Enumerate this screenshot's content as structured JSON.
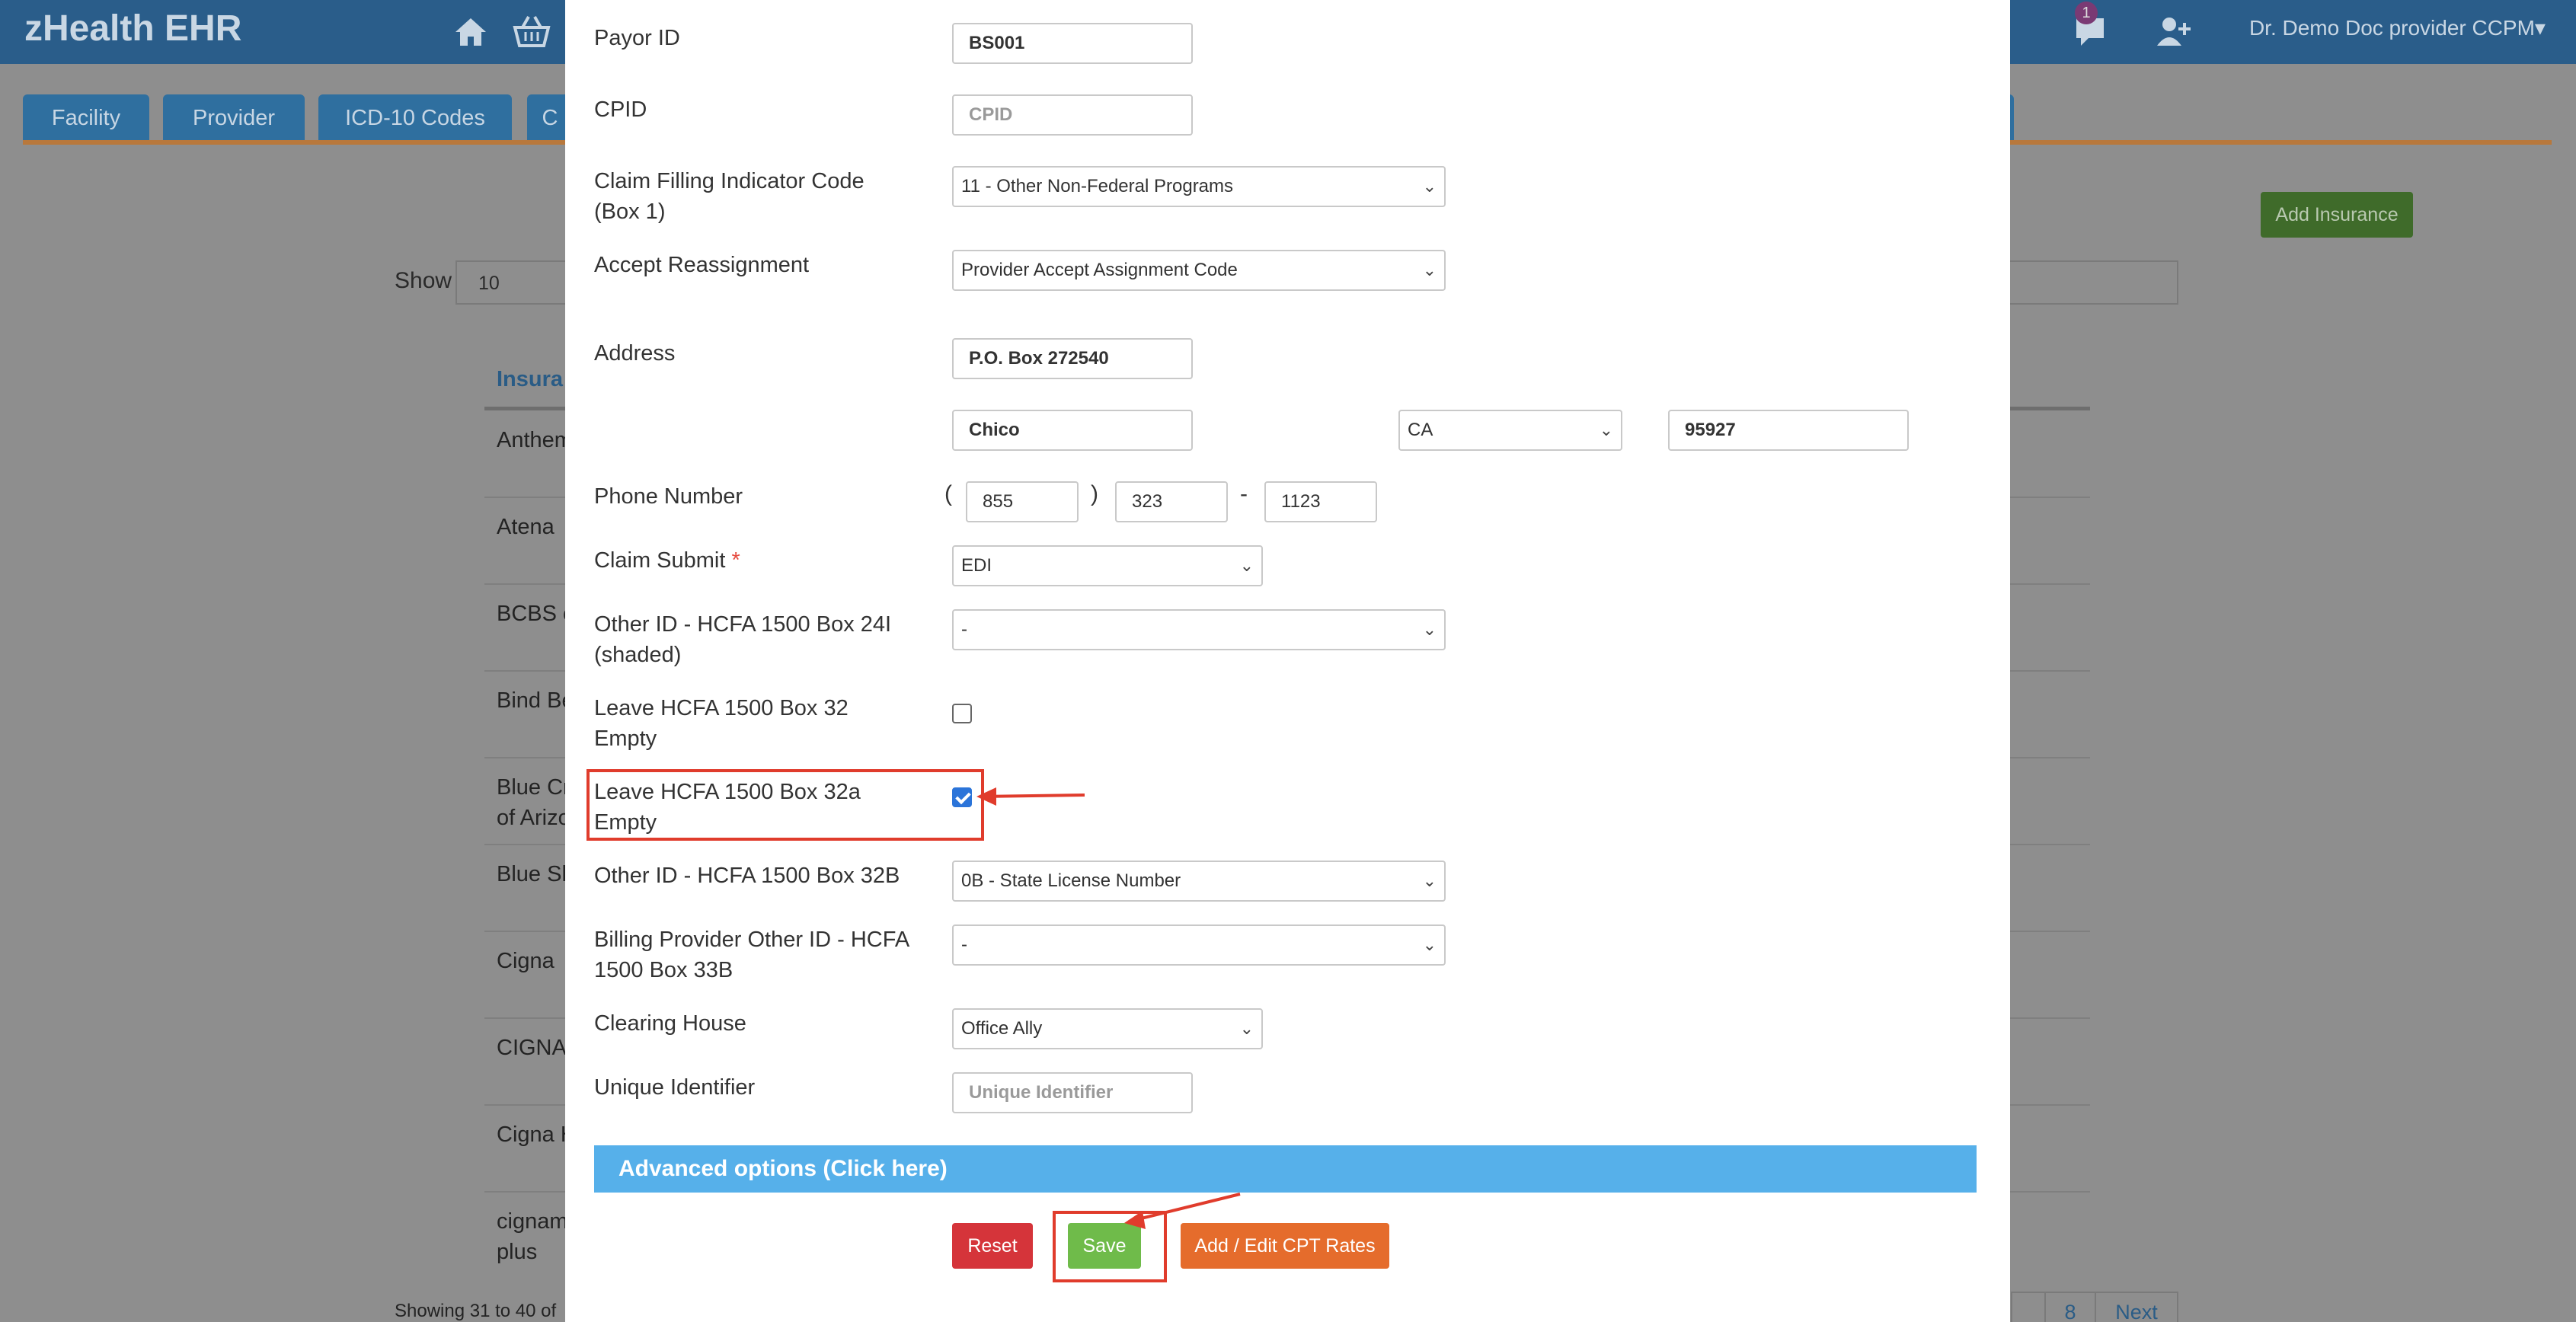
{
  "app": {
    "title": "zHealth EHR",
    "user_menu": "Dr. Demo Doc provider CCPM▾",
    "notification_count": "1"
  },
  "tabs": [
    "Facility",
    "Provider",
    "ICD-10 Codes",
    "C"
  ],
  "list_page": {
    "add_insurance_label": "Add Insurance",
    "show_label": "Show",
    "show_value": "10",
    "column_header": "Insura",
    "rows": [
      "Anthem",
      "Atena",
      "BCBS c",
      "Bind Be",
      "Blue Cr\nof Arizo",
      "Blue Sh",
      "Cigna",
      "CIGNA",
      "Cigna H",
      "cignam\nplus"
    ],
    "showing_text": "Showing 31 to 40 of",
    "pagination": {
      "page_label": "8",
      "next_label": "Next"
    }
  },
  "form": {
    "payor_id": {
      "label": "Payor ID",
      "value": "BS001"
    },
    "cpid": {
      "label": "CPID",
      "placeholder": "CPID"
    },
    "claim_filing_indicator": {
      "label": "Claim Filling Indicator Code\n(Box 1)",
      "value": "11 - Other Non-Federal Programs"
    },
    "accept_reassignment": {
      "label": "Accept Reassignment",
      "value": "Provider Accept Assignment Code"
    },
    "address": {
      "label": "Address",
      "line1": "P.O. Box 272540",
      "city": "Chico",
      "state": "CA",
      "zip": "95927"
    },
    "phone": {
      "label": "Phone Number",
      "area": "855",
      "prefix": "323",
      "line": "1123",
      "open_paren": "(",
      "close_paren": ")",
      "dash": "-"
    },
    "claim_submit": {
      "label": "Claim Submit",
      "required_mark": "*",
      "value": "EDI"
    },
    "other_id_24i": {
      "label": "Other ID - HCFA 1500 Box 24I\n(shaded)",
      "value": "-"
    },
    "leave_box_32": {
      "label": "Leave HCFA 1500 Box 32\nEmpty",
      "checked": false
    },
    "leave_box_32a": {
      "label": "Leave HCFA 1500 Box 32a\nEmpty",
      "checked": true
    },
    "other_id_32b": {
      "label": "Other ID - HCFA 1500 Box 32B",
      "value": "0B - State License Number"
    },
    "billing_other_id_33b": {
      "label": "Billing Provider Other ID - HCFA\n1500 Box 33B",
      "value": "-"
    },
    "clearing_house": {
      "label": "Clearing House",
      "value": "Office Ally"
    },
    "unique_identifier": {
      "label": "Unique Identifier",
      "placeholder": "Unique Identifier"
    },
    "advanced_options_label": "Advanced options (Click here)",
    "buttons": {
      "reset": "Reset",
      "save": "Save",
      "cpt_rates": "Add / Edit CPT Rates"
    }
  },
  "colors": {
    "accent_blue": "#56b0ea",
    "save_green": "#6fbb4a",
    "reset_red": "#d5343a",
    "cpt_orange": "#e56c2c",
    "annotation_red": "#e03c2c",
    "checkbox_blue": "#2b74d9"
  }
}
